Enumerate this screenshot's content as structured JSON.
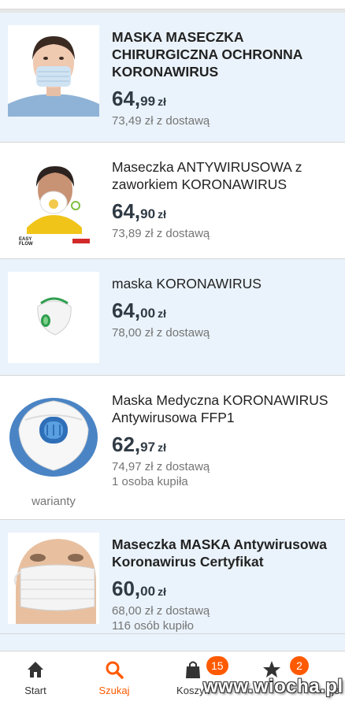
{
  "accent_color": "#ff5a00",
  "products": [
    {
      "title": "MASKA MASECZKA CHIRURGICZNA OCHRONNA KORONAWIRUS",
      "price_int": "64,",
      "price_dec": "99",
      "currency": "zł",
      "delivery": "73,49 zł z dostawą",
      "image": "surgical-mask-model-image"
    },
    {
      "title": "Maseczka ANTYWIRUSOWA z zaworkiem KORONAWIRUS",
      "price_int": "64,",
      "price_dec": "90",
      "currency": "zł",
      "delivery": "73,89 zł z dostawą",
      "image": "valve-mask-worker-image",
      "logo_text": "EASY FLOW"
    },
    {
      "title": "maska KORONAWIRUS",
      "price_int": "64,",
      "price_dec": "00",
      "currency": "zł",
      "delivery": "78,00 zł z dostawą",
      "image": "ffp-mask-image"
    },
    {
      "title": "Maska Medyczna KORONAWIRUS Antywirusowa FFP1",
      "price_int": "62,",
      "price_dec": "97",
      "currency": "zł",
      "delivery": "74,97 zł z dostawą",
      "sold": "1 osoba kupiła",
      "variants": "warianty",
      "image": "ffp1-mask-image"
    },
    {
      "title": "Maseczka MASKA Antywirusowa Koronawirus Certyfikat",
      "price_int": "60,",
      "price_dec": "00",
      "currency": "zł",
      "delivery": "68,00 zł z dostawą",
      "sold": "116 osób kupiło",
      "image": "mannequin-mask-image"
    }
  ],
  "nav": {
    "start": "Start",
    "search": "Szukaj",
    "cart": "Koszyk",
    "cart_badge": "15",
    "watched_badge": "2",
    "mine_partial": "oje"
  },
  "watermark": "www.wiocha.pl"
}
